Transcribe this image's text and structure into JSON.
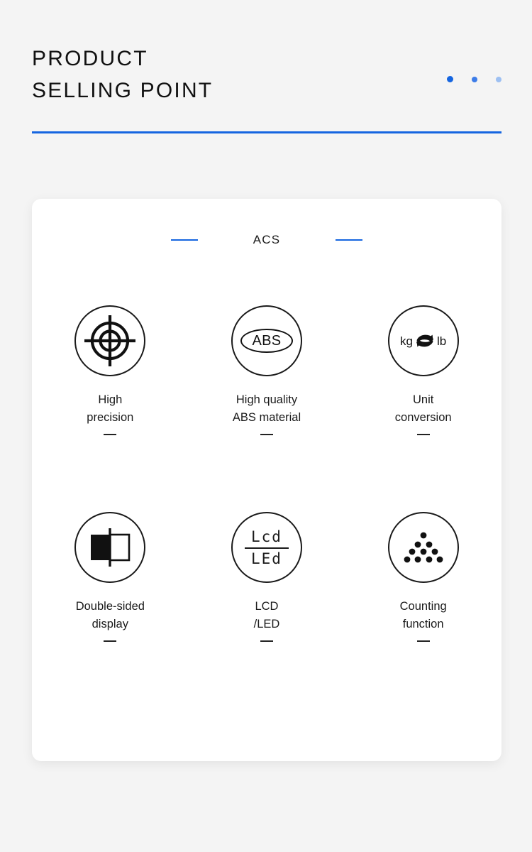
{
  "header": {
    "title": "PRODUCT\nSELLING POINT",
    "accent_color": "#1565e0",
    "pagination_dots": [
      {
        "name": "dot-active",
        "color": "#1565e0"
      },
      {
        "name": "dot-2",
        "color": "#3d7ce8"
      },
      {
        "name": "dot-3",
        "color": "#9dc0f2"
      }
    ]
  },
  "card": {
    "brand": "ACS",
    "features": [
      {
        "icon": "crosshair-target-icon",
        "label": "High\nprecision"
      },
      {
        "icon": "abs-ellipse-icon",
        "icon_text": "ABS",
        "label": "High quality\nABS material"
      },
      {
        "icon": "unit-conversion-icon",
        "icon_text_left": "kg",
        "icon_text_right": "lb",
        "label": "Unit\nconversion"
      },
      {
        "icon": "double-sided-display-icon",
        "label": "Double-sided\ndisplay"
      },
      {
        "icon": "lcd-led-icon",
        "icon_text_top": "Lcd",
        "icon_text_bottom": "LEd",
        "label": "LCD\n/LED"
      },
      {
        "icon": "counting-dots-icon",
        "label": "Counting\nfunction"
      }
    ]
  }
}
